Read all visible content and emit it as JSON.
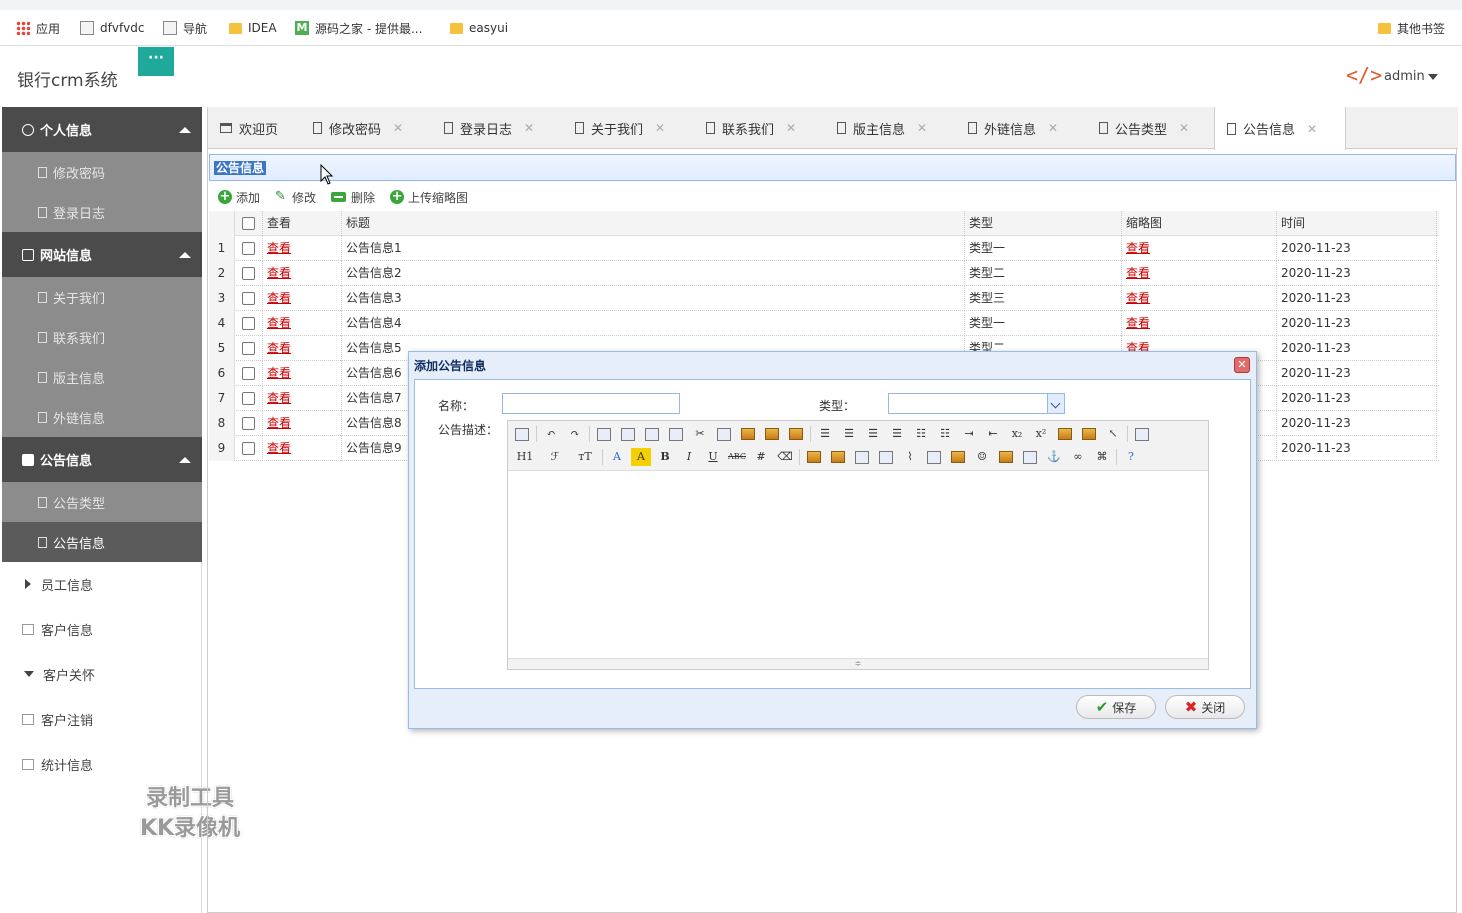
{
  "bookmarks": [
    {
      "label": "应用",
      "icon": "apps-icon"
    },
    {
      "label": "dfvfvdc",
      "icon": "page-icon"
    },
    {
      "label": "导航",
      "icon": "page-icon"
    },
    {
      "label": "IDEA",
      "icon": "folder-icon"
    },
    {
      "label": "源码之家 - 提供最...",
      "icon": "m-logo-icon"
    },
    {
      "label": "easyui",
      "icon": "folder-icon"
    }
  ],
  "other_bookmarks": "其他书签",
  "header": {
    "app_title": "银行crm系统",
    "menu_button": "···",
    "logo_code": "</>",
    "user": "admin"
  },
  "sidebar": {
    "personal": {
      "title": "个人信息",
      "items": [
        "修改密码",
        "登录日志"
      ]
    },
    "website": {
      "title": "网站信息",
      "items": [
        "关于我们",
        "联系我们",
        "版主信息",
        "外链信息"
      ]
    },
    "notice": {
      "title": "公告信息",
      "items": [
        "公告类型",
        "公告信息"
      ]
    },
    "others": [
      "员工信息",
      "客户信息",
      "客户关怀",
      "客户注销",
      "统计信息"
    ]
  },
  "watermark": {
    "line1": "录制工具",
    "line2": "KK录像机"
  },
  "tabs": [
    "欢迎页",
    "修改密码",
    "登录日志",
    "关于我们",
    "联系我们",
    "版主信息",
    "外链信息",
    "公告类型",
    "公告信息"
  ],
  "panel": {
    "title": "公告信息",
    "toolbar": {
      "add": "添加",
      "edit": "修改",
      "delete": "删除",
      "upload": "上传缩略图"
    }
  },
  "grid": {
    "columns": {
      "view": "查看",
      "title": "标题",
      "type": "类型",
      "thumb": "缩略图",
      "time": "时间"
    },
    "link_text": "查看",
    "rows": [
      {
        "n": "1",
        "title": "公告信息1",
        "type": "类型一",
        "time": "2020-11-23"
      },
      {
        "n": "2",
        "title": "公告信息2",
        "type": "类型二",
        "time": "2020-11-23"
      },
      {
        "n": "3",
        "title": "公告信息3",
        "type": "类型三",
        "time": "2020-11-23"
      },
      {
        "n": "4",
        "title": "公告信息4",
        "type": "类型一",
        "time": "2020-11-23"
      },
      {
        "n": "5",
        "title": "公告信息5",
        "type": "类型二",
        "time": "2020-11-23"
      },
      {
        "n": "6",
        "title": "公告信息6",
        "type": "",
        "time": "2020-11-23"
      },
      {
        "n": "7",
        "title": "公告信息7",
        "type": "",
        "time": "2020-11-23"
      },
      {
        "n": "8",
        "title": "公告信息8",
        "type": "",
        "time": "2020-11-23"
      },
      {
        "n": "9",
        "title": "公告信息9",
        "type": "",
        "time": "2020-11-23"
      }
    ]
  },
  "dialog": {
    "title": "添加公告信息",
    "name_label": "名称：",
    "name_value": "",
    "type_label": "类型：",
    "type_value": "",
    "desc_label": "公告描述：",
    "editor_toolbar_row2": [
      "H1",
      "ℱ",
      "тT",
      "A",
      "A",
      "B",
      "I",
      "U",
      "ABC"
    ],
    "save": "保存",
    "close": "关闭"
  }
}
